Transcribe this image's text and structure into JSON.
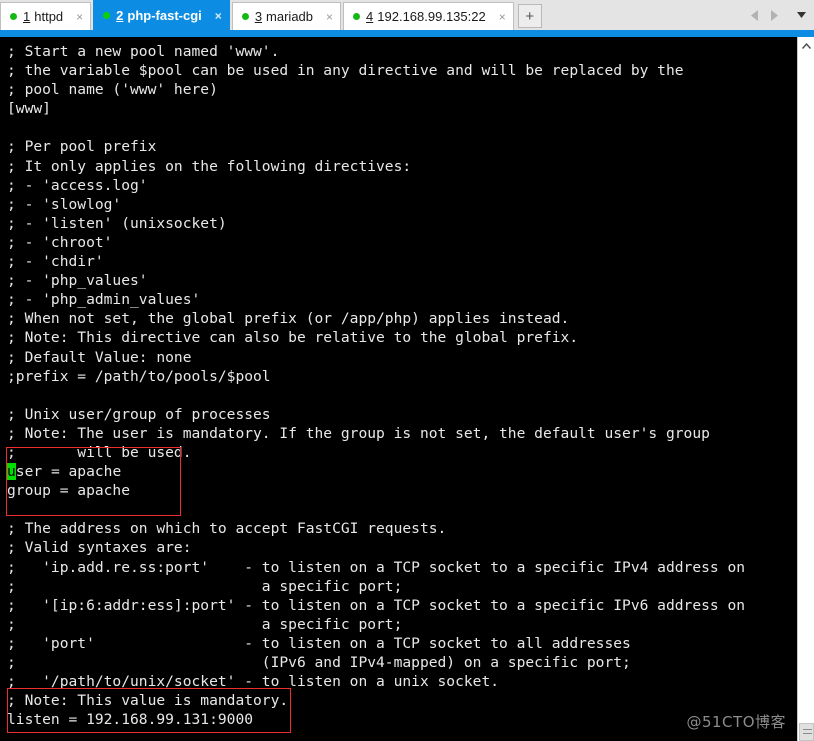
{
  "tabbar": {
    "tabs": [
      {
        "number": "1",
        "label": "httpd",
        "status_color": "#14b814",
        "active": false,
        "close_label": "×"
      },
      {
        "number": "2",
        "label": "php-fast-cgi",
        "status_color": "#0ad00a",
        "active": true,
        "close_label": "×"
      },
      {
        "number": "3",
        "label": "mariadb",
        "status_color": "#14b814",
        "active": false,
        "close_label": "×"
      },
      {
        "number": "4",
        "label": "192.168.99.135:22",
        "status_color": "#14b814",
        "active": false,
        "close_label": "×"
      }
    ],
    "new_tab_label": "+",
    "prev_icon": "triangle-left-icon",
    "next_icon": "triangle-right-icon",
    "menu_icon": "chevron-down-icon",
    "accent_color": "#0c8ce2"
  },
  "terminal": {
    "background_color": "#000000",
    "text_color": "#e8e8e8",
    "cursor_color": "#00e000",
    "cursor_char": "u",
    "lines": [
      "; Start a new pool named 'www'.",
      "; the variable $pool can be used in any directive and will be replaced by the",
      "; pool name ('www' here)",
      "[www]",
      "",
      "; Per pool prefix",
      "; It only applies on the following directives:",
      "; - 'access.log'",
      "; - 'slowlog'",
      "; - 'listen' (unixsocket)",
      "; - 'chroot'",
      "; - 'chdir'",
      "; - 'php_values'",
      "; - 'php_admin_values'",
      "; When not set, the global prefix (or /app/php) applies instead.",
      "; Note: This directive can also be relative to the global prefix.",
      "; Default Value: none",
      ";prefix = /path/to/pools/$pool",
      "",
      "; Unix user/group of processes",
      "; Note: The user is mandatory. If the group is not set, the default user's group",
      ";       will be used.",
      "CURSOR_USER_LINE",
      "group = apache",
      "",
      "; The address on which to accept FastCGI requests.",
      "; Valid syntaxes are:",
      ";   'ip.add.re.ss:port'    - to listen on a TCP socket to a specific IPv4 address on",
      ";                            a specific port;",
      ";   '[ip:6:addr:ess]:port' - to listen on a TCP socket to a specific IPv6 address on",
      ";                            a specific port;",
      ";   'port'                 - to listen on a TCP socket to all addresses",
      ";                            (IPv6 and IPv4-mapped) on a specific port;",
      ";   '/path/to/unix/socket' - to listen on a unix socket.",
      "; Note: This value is mandatory.",
      "listen = 192.168.99.131:9000"
    ],
    "cursor_line_rest": "ser = apache"
  },
  "annotations": {
    "color": "#ef2d2d",
    "boxes": [
      {
        "name": "user-group-highlight",
        "target": "user = apache / group = apache"
      },
      {
        "name": "listen-directive-highlight",
        "target": "listen = 192.168.99.131:9000"
      }
    ]
  },
  "watermark": {
    "text": "@51CTO博客",
    "color": "#8c8c8c"
  },
  "scrollbar": {
    "up_icon": "caret-up-icon",
    "position": "bottom"
  }
}
